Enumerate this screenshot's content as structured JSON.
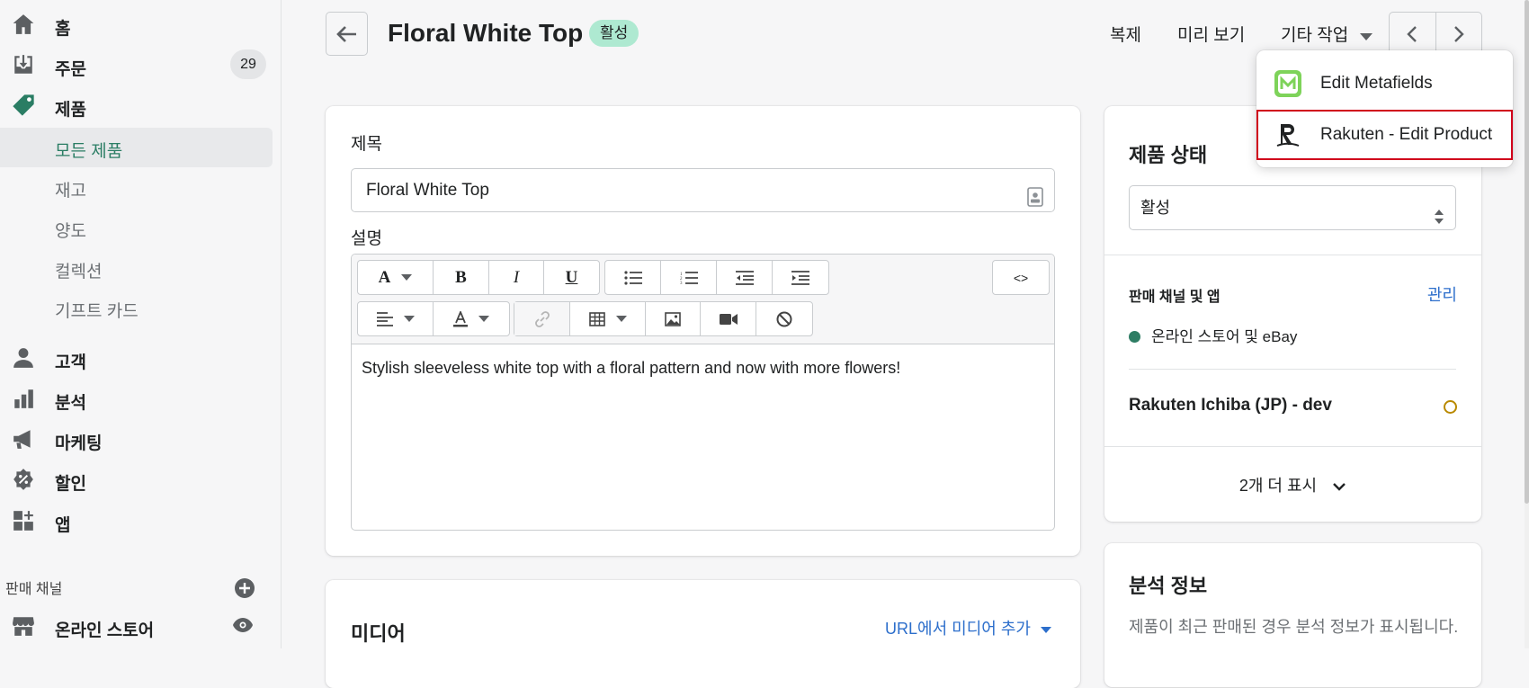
{
  "sidebar": {
    "home": "홈",
    "orders": "주문",
    "orders_count": "29",
    "products": "제품",
    "sub": [
      "모든 제품",
      "재고",
      "양도",
      "컬렉션",
      "기프트 카드"
    ],
    "customers": "고객",
    "analytics": "분석",
    "marketing": "마케팅",
    "discounts": "할인",
    "apps": "앱",
    "sales_channels": "판매 채널",
    "online_store": "온라인 스토어"
  },
  "header": {
    "title": "Floral White Top",
    "badge": "활성",
    "duplicate": "복제",
    "preview": "미리 보기",
    "more_actions": "기타 작업"
  },
  "dropdown": {
    "items": [
      "Edit Metafields",
      "Rakuten - Edit Product"
    ]
  },
  "product": {
    "title_label": "제목",
    "title_value": "Floral White Top",
    "description_label": "설명",
    "description": "Stylish sleeveless white top with a floral pattern and now with more flowers!",
    "code_toggle": "<>"
  },
  "media": {
    "title": "미디어",
    "add_from_url": "URL에서 미디어 추가"
  },
  "status": {
    "title": "제품 상태",
    "value": "활성",
    "channels_title": "판매 채널 및 앱",
    "manage": "관리",
    "channel_1": "온라인 스토어 및 eBay",
    "channel_2": "Rakuten Ichiba (JP) - dev",
    "show_more": "2개 더 표시"
  },
  "analytics": {
    "title": "분석 정보",
    "text": "제품이 최근 판매된 경우 분석 정보가 표시됩니다."
  },
  "colors": {
    "accent_green": "#2a7d64",
    "link_blue": "#2c6ecb",
    "badge_green": "#aee9d1",
    "highlight_red": "#d0021b"
  }
}
